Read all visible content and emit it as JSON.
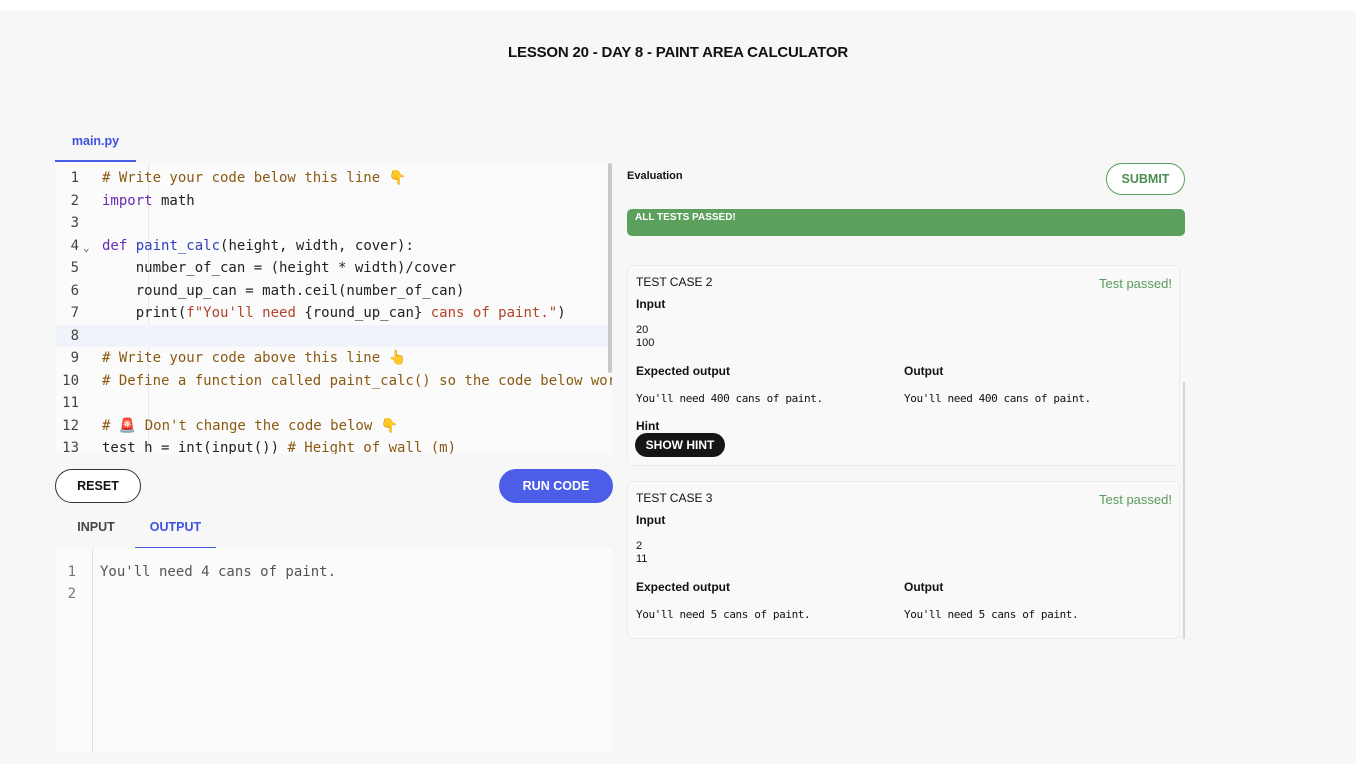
{
  "page_title": "LESSON 20 - DAY 8 - PAINT AREA CALCULATOR",
  "editor": {
    "file_tab": "main.py",
    "lines": [
      {
        "n": "1",
        "parts": [
          [
            "c-com",
            "# Write your code below this line 👇"
          ]
        ]
      },
      {
        "n": "2",
        "parts": [
          [
            "c-kw",
            "import"
          ],
          [
            "",
            " math"
          ]
        ]
      },
      {
        "n": "3",
        "parts": []
      },
      {
        "n": "4",
        "fold": "⌄",
        "parts": [
          [
            "c-kw",
            "def"
          ],
          [
            "",
            " "
          ],
          [
            "c-fn",
            "paint_calc"
          ],
          [
            "",
            "(height, width, cover):"
          ]
        ]
      },
      {
        "n": "5",
        "parts": [
          [
            "",
            "    number_of_can = (height * width)/cover"
          ]
        ]
      },
      {
        "n": "6",
        "parts": [
          [
            "",
            "    round_up_can = math.ceil(number_of_can)"
          ]
        ]
      },
      {
        "n": "7",
        "parts": [
          [
            "",
            "    print("
          ],
          [
            "c-str",
            "f\"You'll need "
          ],
          [
            "",
            "{round_up_can}"
          ],
          [
            "c-str",
            " cans of paint.\""
          ],
          [
            "",
            ")"
          ]
        ]
      },
      {
        "n": "8",
        "parts": [],
        "active": true
      },
      {
        "n": "9",
        "parts": [
          [
            "c-com",
            "# Write your code above this line 👆"
          ]
        ]
      },
      {
        "n": "10",
        "parts": [
          [
            "c-com",
            "# Define a function called paint_calc() so the code below works"
          ]
        ]
      },
      {
        "n": "11",
        "parts": []
      },
      {
        "n": "12",
        "parts": [
          [
            "c-com",
            "# 🚨 Don't change the code below 👇"
          ]
        ]
      },
      {
        "n": "13",
        "parts": [
          [
            "",
            "test_h = int(input()) "
          ],
          [
            "c-com",
            "# Height of wall (m)"
          ]
        ]
      }
    ]
  },
  "buttons": {
    "reset": "RESET",
    "run": "RUN CODE",
    "submit": "SUBMIT",
    "show_hint": "SHOW HINT"
  },
  "io_tabs": {
    "input": "INPUT",
    "output": "OUTPUT"
  },
  "console": {
    "lines": [
      {
        "n": "1",
        "text": "You'll need 4 cans of paint."
      },
      {
        "n": "2",
        "text": ""
      }
    ]
  },
  "evaluation": {
    "title": "Evaluation",
    "banner": "ALL TESTS PASSED!",
    "labels": {
      "input": "Input",
      "expected": "Expected output",
      "output": "Output",
      "hint": "Hint"
    },
    "cases": [
      {
        "name": "TEST CASE 2",
        "status": "Test passed!",
        "input_1": "20",
        "input_2": "100",
        "expected": "You'll need 400 cans of paint.",
        "output": "You'll need 400 cans of paint."
      },
      {
        "name": "TEST CASE 3",
        "status": "Test passed!",
        "input_1": "2",
        "input_2": "11",
        "expected": "You'll need 5 cans of paint.",
        "output": "You'll need 5 cans of paint."
      }
    ]
  },
  "colors": {
    "accent": "#4c5de8",
    "success": "#5ca05d"
  }
}
